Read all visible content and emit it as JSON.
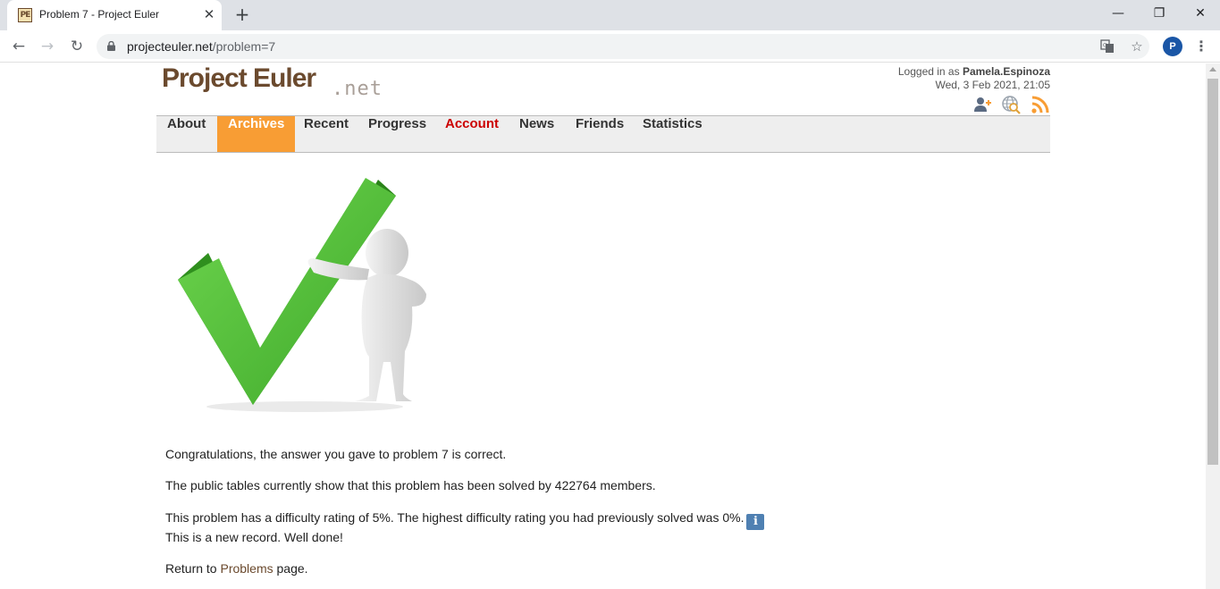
{
  "browser": {
    "tab_title": "Problem 7 - Project Euler",
    "tab_favicon_text": "PE",
    "url_host": "projecteuler.net",
    "url_path": "/problem=7",
    "profile_initial": "P"
  },
  "header": {
    "logo_main": "Project Euler",
    "logo_sub": ".net",
    "logged_in_prefix": "Logged in as",
    "username": "Pamela.Espinoza",
    "datetime": "Wed, 3 Feb 2021, 21:05"
  },
  "nav": {
    "items": [
      "About",
      "Archives",
      "Recent",
      "Progress",
      "Account",
      "News",
      "Friends",
      "Statistics"
    ],
    "active": "Archives"
  },
  "content": {
    "congrats": "Congratulations, the answer you gave to problem 7 is correct.",
    "public_tables": "The public tables currently show that this problem has been solved by 422764 members.",
    "difficulty": "This problem has a difficulty rating of 5%. The highest difficulty rating you had previously solved was 0%.",
    "info_icon": "i",
    "record": "This is a new record. Well done!",
    "return_prefix": "Return to",
    "return_link": "Problems",
    "return_suffix": "page."
  },
  "colors": {
    "brand_brown": "#6b4a2e",
    "nav_active": "#f89d34",
    "account_red": "#cc0000",
    "check_green": "#4fbf3a",
    "info_blue": "#4f80b2"
  }
}
